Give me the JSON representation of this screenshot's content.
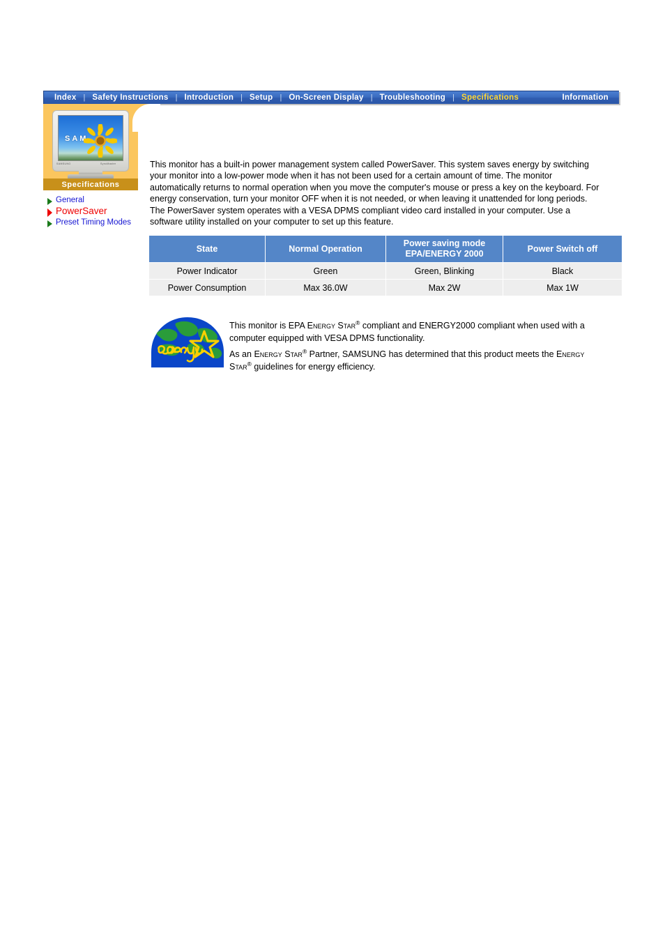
{
  "nav": {
    "separator": "|",
    "items": [
      {
        "label": "Index",
        "active": false
      },
      {
        "label": "Safety Instructions",
        "active": false
      },
      {
        "label": "Introduction",
        "active": false
      },
      {
        "label": "Setup",
        "active": false
      },
      {
        "label": "On-Screen Display",
        "active": false
      },
      {
        "label": "Troubleshooting",
        "active": false
      },
      {
        "label": "Specifications",
        "active": true
      },
      {
        "label": "Information",
        "active": false
      }
    ]
  },
  "sidebar": {
    "section_label": "Specifications",
    "thumbnail": {
      "screen_text": "SAM",
      "brand_label": "SAMSUNG",
      "model_label": "SyncMaster"
    },
    "items": [
      {
        "label": "General",
        "current": false
      },
      {
        "label": "PowerSaver",
        "current": true
      },
      {
        "label": "Preset Timing Modes",
        "current": false
      }
    ]
  },
  "main": {
    "intro": "This monitor has a built-in power management system called PowerSaver. This system saves energy by switching your monitor into a low-power mode when it has not been used for a certain amount of time. The monitor automatically returns to normal operation when you move the computer's mouse or press a key on the keyboard. For energy conservation, turn your monitor OFF when it is not needed, or when leaving it unattended for long periods. The PowerSaver system operates with a VESA DPMS compliant video card installed in your computer. Use a software utility installed on your computer to set up this feature."
  },
  "table": {
    "headers": [
      "State",
      "Normal Operation",
      "Power saving mode EPA/ENERGY 2000",
      "Power Switch off"
    ],
    "header_saving_line1": "Power saving mode",
    "header_saving_line2": "EPA/ENERGY 2000",
    "rows": [
      {
        "state": "Power Indicator",
        "normal": "Green",
        "saving": "Green, Blinking",
        "off": "Black"
      },
      {
        "state": "Power Consumption",
        "normal": "Max 36.0W",
        "saving": "Max 2W",
        "off": "Max 1W"
      }
    ]
  },
  "energy_star": {
    "logo_word": "energy",
    "p1_a": "This monitor is EPA ",
    "p1_sc1": "Energy Star",
    "p1_b": " compliant and ENERGY2000 compliant when used with a computer equipped with VESA DPMS functionality.",
    "p2_a": "As an ",
    "p2_sc1": "Energy Star",
    "p2_b": " Partner, SAMSUNG has determined that this product meets the ",
    "p2_sc2": "Energy Star",
    "p2_c": " guidelines for energy efficiency.",
    "registered_mark": "®"
  },
  "colors": {
    "nav_blue": "#3a6cc0",
    "nav_active_text": "#ffd633",
    "orange_panel": "#fbc65e",
    "gold_band": "#c8901a",
    "table_header_blue": "#5486c8",
    "table_cell_gray": "#eeeeee",
    "link_blue": "#1414d2",
    "current_link_red": "#ee0000",
    "arrow_green": "#1a7a1a"
  }
}
